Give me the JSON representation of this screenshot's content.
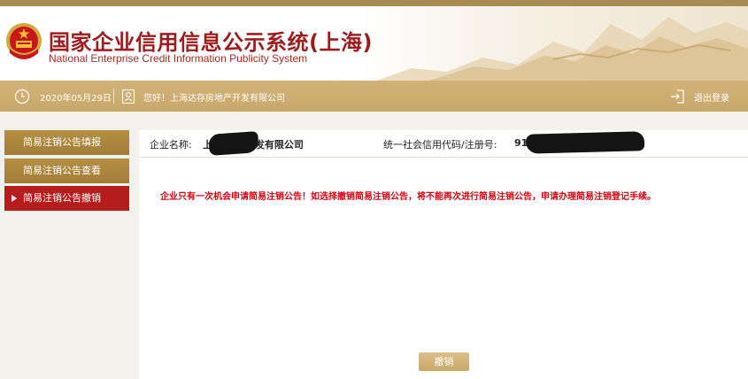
{
  "header": {
    "title_cn": "国家企业信用信息公示系统(上海)",
    "title_en": "National Enterprise Credit Information Publicity System",
    "emblem_icon": "national-emblem-icon"
  },
  "infobar": {
    "date": "2020年05月29日",
    "greeting": "您好！上海达存房地产开发有限公司",
    "logout": "退出登录",
    "icons": {
      "clock": "clock-icon",
      "user": "user-card-icon",
      "logout": "logout-arrow-icon"
    }
  },
  "sidebar": {
    "items": [
      {
        "label": "简易注销公告填报",
        "active": false
      },
      {
        "label": "简易注销公告查看",
        "active": false
      },
      {
        "label": "简易注销公告撤销",
        "active": true
      }
    ]
  },
  "main": {
    "company_label": "企业名称:",
    "company_value": "上          房地产开发有限公司",
    "code_label": "统一社会信用代码/注册号:",
    "code_value": "91",
    "warning": "企业只有一次机会申请简易注销公告！如选择撤销简易注销公告，将不能再次进行简易注销公告，申请办理简易注销登记手续。",
    "revoke_button": "撤销"
  },
  "colors": {
    "brand_red": "#9d1d1e",
    "gold_bar": "#c9a86a",
    "sidebar_gold": "#a27d36",
    "sidebar_active": "#b51d1d",
    "warning_red": "#d6000f"
  }
}
